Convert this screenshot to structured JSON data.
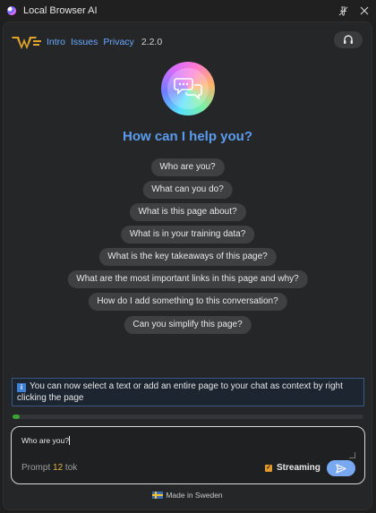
{
  "window": {
    "title": "Local Browser AI",
    "pin_icon": "pin-icon",
    "close_icon": "close-icon"
  },
  "header": {
    "nav": [
      {
        "label": "Intro"
      },
      {
        "label": "Issues"
      },
      {
        "label": "Privacy"
      }
    ],
    "version": "2.2.0",
    "headset_icon": "headset-icon",
    "accent_color": "#69a8ff"
  },
  "main": {
    "heading": "How can I help you?",
    "suggestions": [
      "Who are you?",
      "What can you do?",
      "What is this page about?",
      "What is in your training data?",
      "What is the key takeaways of this page?",
      "What are the most important links in this page and why?",
      "How do I add something to this conversation?",
      "Can you simplify this page?"
    ]
  },
  "info": {
    "icon": "info-icon",
    "text": "You can now select a text or add an entire page to your chat as context by right clicking the page"
  },
  "progress": {
    "value_fraction": 0.02
  },
  "composer": {
    "input_value": "Who are you?",
    "token_label": "Prompt",
    "token_count": "12",
    "token_unit": "tok",
    "streaming_label": "Streaming",
    "streaming_checked": true,
    "send_icon": "send-icon"
  },
  "footer": {
    "text": "Made in Sweden",
    "flag_icon": "sweden-flag-icon"
  }
}
